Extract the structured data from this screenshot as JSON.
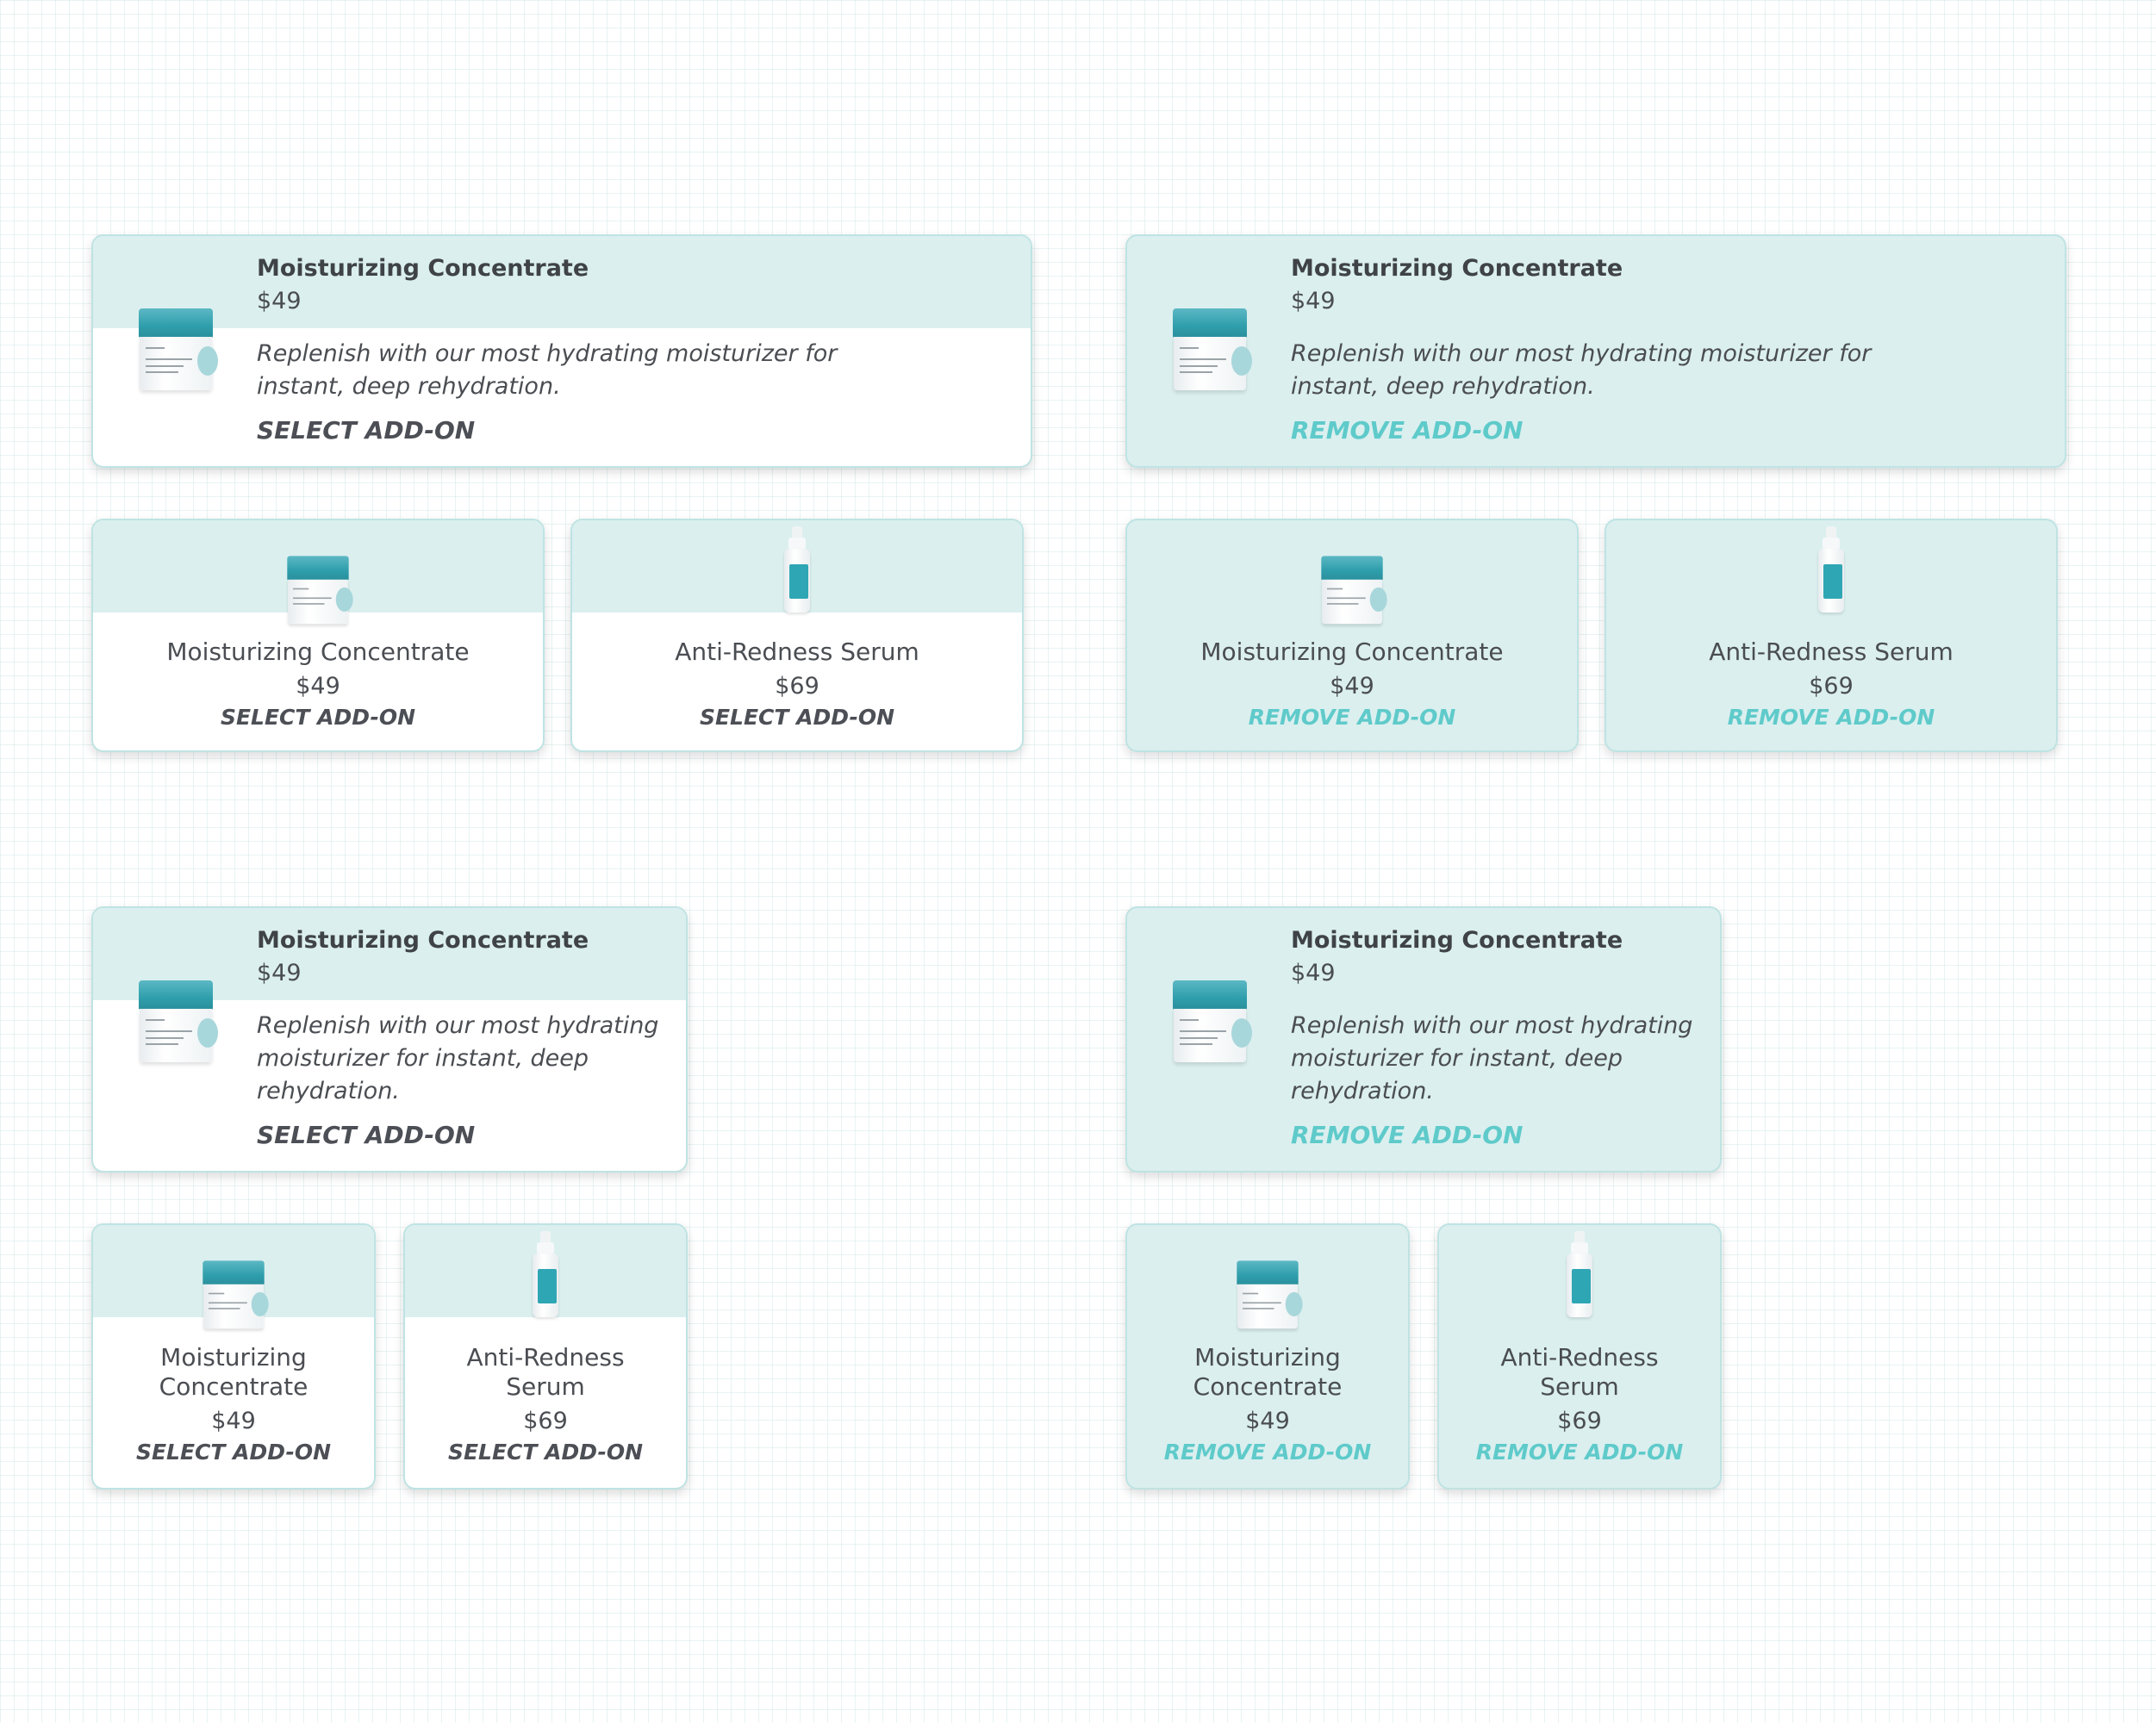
{
  "colors": {
    "band": "#dbefef",
    "border": "#bfe3e3",
    "accent": "#5fcaca",
    "text": "#4a4d52"
  },
  "icons": {
    "jar": "moisturizer-jar-image",
    "bottle": "serum-bottle-image"
  },
  "products": {
    "moisturizer": {
      "name": "Moisturizing Concentrate",
      "name_line1": "Moisturizing",
      "name_line2": "Concentrate",
      "price": "$49",
      "description": "Replenish with our most hydrating moisturizer for instant, deep rehydration."
    },
    "serum": {
      "name": "Anti-Redness Serum",
      "name_line1": "Anti-Redness",
      "name_line2": "Serum",
      "price": "$69"
    }
  },
  "actions": {
    "select": "SELECT ADD-ON",
    "remove": "REMOVE ADD-ON"
  }
}
